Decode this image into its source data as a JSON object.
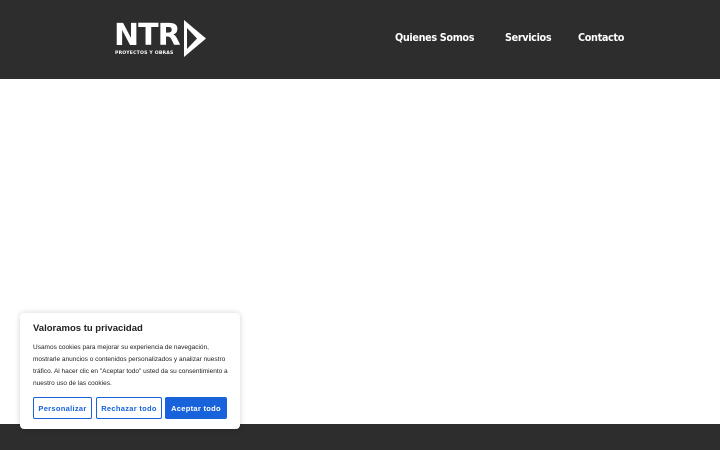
{
  "header": {
    "logo": {
      "text": "NTR",
      "tagline": "PROYECTOS Y OBRAS"
    },
    "nav": [
      {
        "label": "Quienes Somos"
      },
      {
        "label": "Servicios"
      },
      {
        "label": "Contacto"
      }
    ]
  },
  "cookie_banner": {
    "title": "Valoramos tu privacidad",
    "body": "Usamos cookies para mejorar su experiencia de navegación, mostrarle anuncios o contenidos personalizados y analizar nuestro tráfico. Al hacer clic en \"Aceptar todo\" usted da su consentimiento a nuestro uso de las cookies.",
    "buttons": {
      "customize": "Personalizar",
      "reject": "Rechazar todo",
      "accept": "Aceptar todo"
    },
    "accent_color": "#1863dc"
  },
  "colors": {
    "header_bg": "#2d2d2d",
    "footer_bg": "#2d2d2d",
    "page_bg": "#ffffff"
  }
}
